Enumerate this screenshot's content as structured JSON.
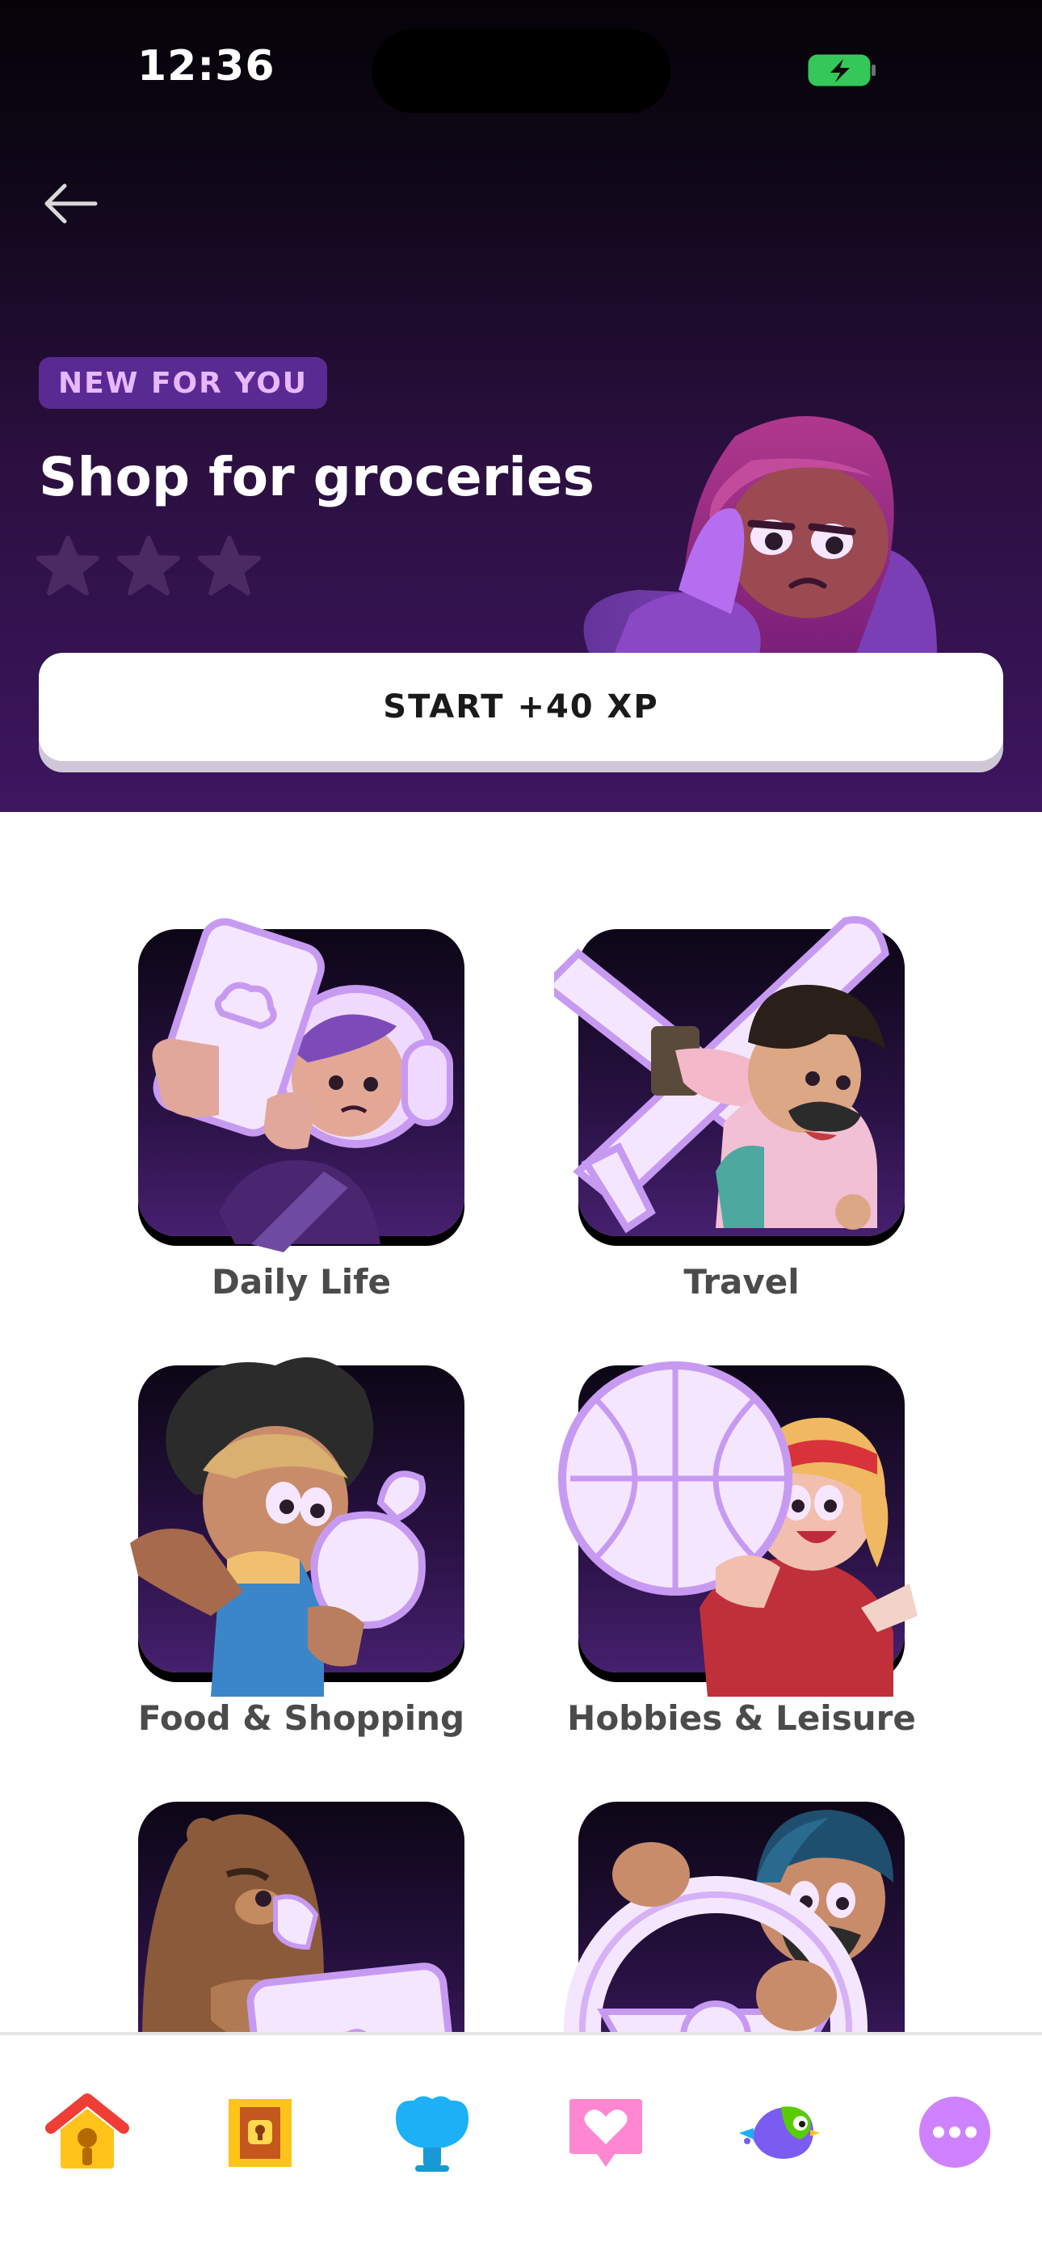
{
  "status_bar": {
    "time": "12:36"
  },
  "hero": {
    "badge": "NEW FOR YOU",
    "title": "Shop for groceries",
    "stars_earned": 0,
    "stars_total": 3,
    "start_button": "START +40 XP",
    "colors": {
      "badge_bg": "#5a2a93",
      "badge_text": "#e6b9ff",
      "star_empty": "#4b2a63"
    }
  },
  "categories": [
    {
      "label": "Daily Life",
      "icon": "phone-character-illustration"
    },
    {
      "label": "Travel",
      "icon": "airplane-character-illustration"
    },
    {
      "label": "Food & Shopping",
      "icon": "grocery-character-illustration"
    },
    {
      "label": "Hobbies & Leisure",
      "icon": "basketball-character-illustration"
    },
    {
      "label": "",
      "icon": "bear-laptop-illustration"
    },
    {
      "label": "",
      "icon": "steering-wheel-illustration"
    }
  ],
  "tabbar": {
    "items": [
      {
        "name": "home",
        "icon": "home-icon"
      },
      {
        "name": "chest",
        "icon": "chest-icon"
      },
      {
        "name": "video-call",
        "icon": "lily-icon"
      },
      {
        "name": "practice",
        "icon": "heart-bubble-icon"
      },
      {
        "name": "profile",
        "icon": "bird-icon"
      },
      {
        "name": "more",
        "icon": "more-icon"
      }
    ]
  }
}
